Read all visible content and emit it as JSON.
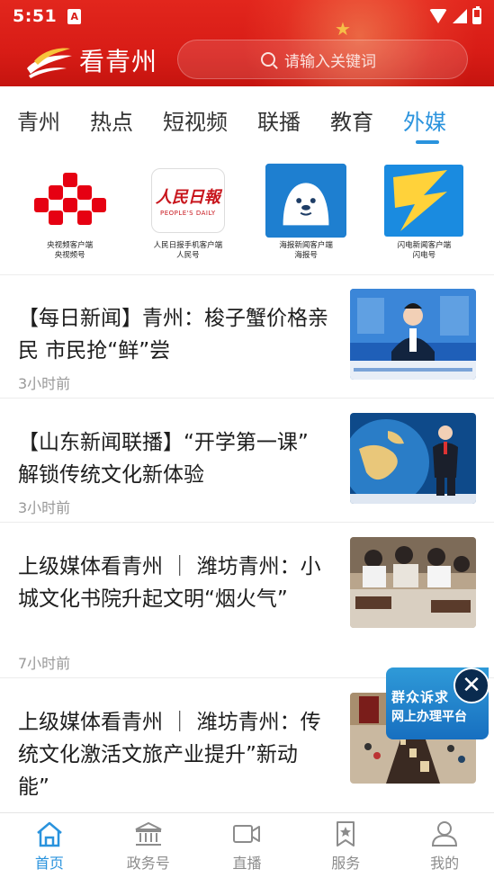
{
  "status_bar": {
    "time": "5:51",
    "notification_badge": "A"
  },
  "header": {
    "app_name": "看青州",
    "search": {
      "placeholder": "请输入关键词"
    }
  },
  "tabs": [
    {
      "label": "青州",
      "active": false
    },
    {
      "label": "热点",
      "active": false
    },
    {
      "label": "短视频",
      "active": false
    },
    {
      "label": "联播",
      "active": false
    },
    {
      "label": "教育",
      "active": false
    },
    {
      "label": "外媒",
      "active": true
    }
  ],
  "media": [
    {
      "label": "央视频客户端",
      "sub": "央视频号",
      "icon": "cctv-video-logo"
    },
    {
      "label": "人民日报手机客户端",
      "sub": "人民号",
      "logo_text": "人民日報",
      "logo_sub": "PEOPLE'S DAILY",
      "icon": "peoples-daily-logo"
    },
    {
      "label": "海报新闻客户端",
      "sub": "海报号",
      "icon": "seal-logo"
    },
    {
      "label": "闪电新闻客户端",
      "sub": "闪电号",
      "icon": "lightning-logo"
    }
  ],
  "news": [
    {
      "title": "【每日新闻】青州：梭子蟹价格亲民  市民抢“鲜”尝",
      "time": "3小时前",
      "thumb": "news-anchor"
    },
    {
      "title": "【山东新闻联播】“开学第一课” 解锁传统文化新体验",
      "time": "3小时前",
      "thumb": "globe-anchor"
    },
    {
      "title": "上级媒体看青州  ｜  潍坊青州：小城文化书院升起文明“烟火气”",
      "time": "7小时前",
      "thumb": "classroom"
    },
    {
      "title": "上级媒体看青州  ｜  潍坊青州：传统文化激活文旅产业提升”新动能”",
      "time": "",
      "thumb": "street"
    }
  ],
  "float_ad": {
    "line1": "群众诉求",
    "line2": "网上办理平台"
  },
  "bottom_nav": [
    {
      "label": "首页",
      "icon": "home-icon",
      "active": true
    },
    {
      "label": "政务号",
      "icon": "government-icon",
      "active": false
    },
    {
      "label": "直播",
      "icon": "video-camera-icon",
      "active": false
    },
    {
      "label": "服务",
      "icon": "bookmark-star-icon",
      "active": false
    },
    {
      "label": "我的",
      "icon": "user-icon",
      "active": false
    }
  ],
  "colors": {
    "header_red": "#d81c16",
    "accent_blue": "#2a93dd"
  }
}
